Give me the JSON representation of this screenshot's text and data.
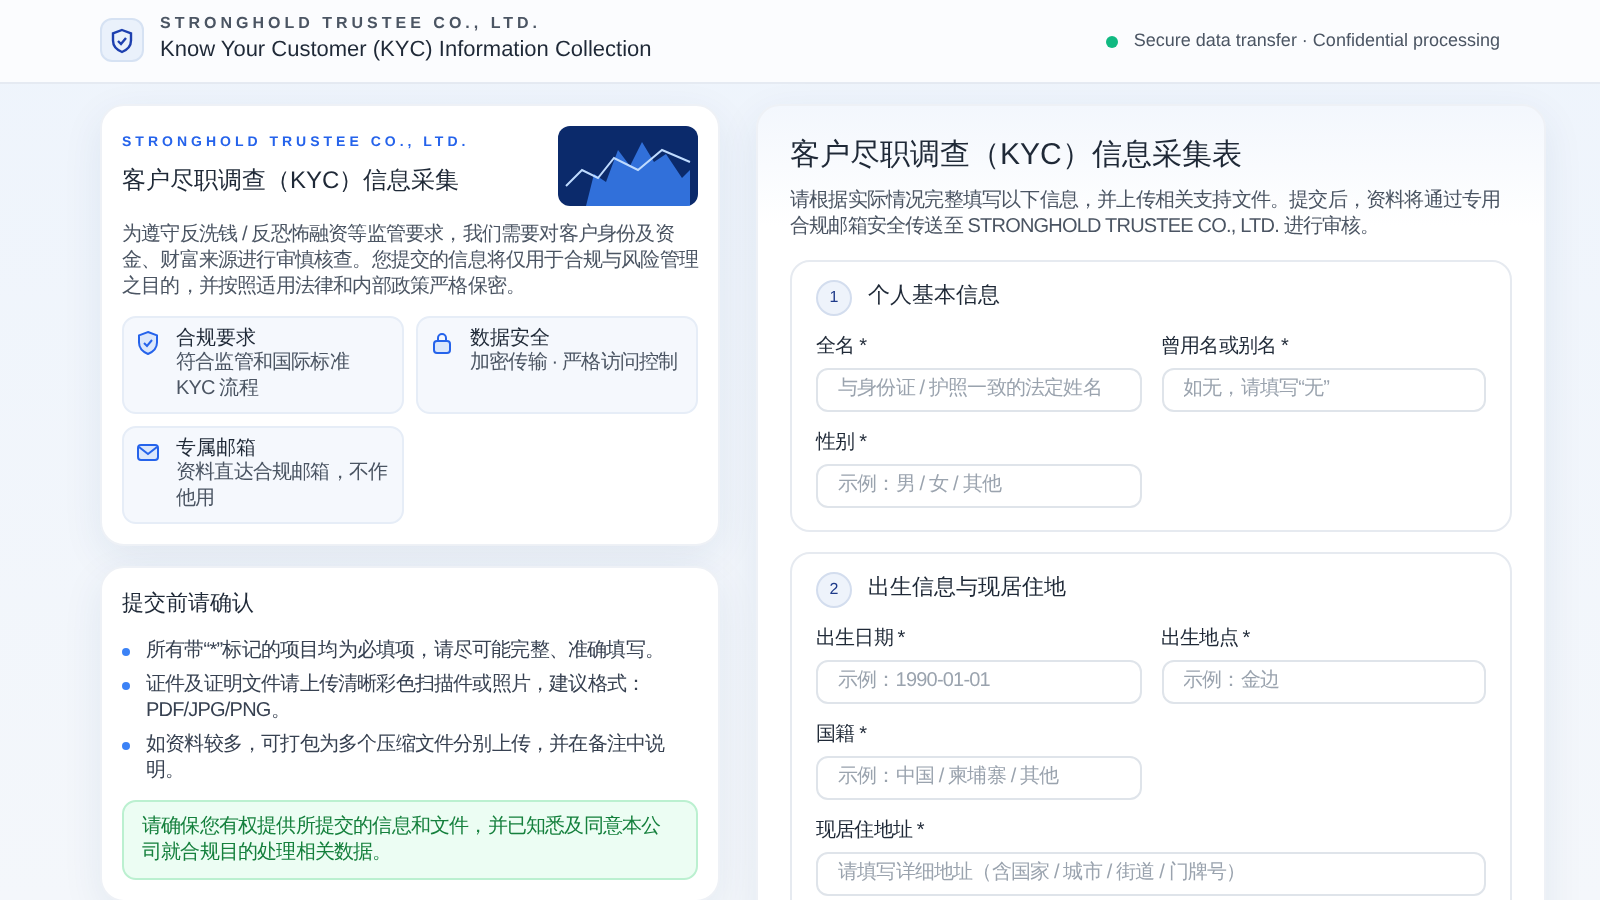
{
  "header": {
    "company": "STRONGHOLD TRUSTEE CO., LTD.",
    "title": "Know Your Customer (KYC) Information Collection",
    "status": "Secure data transfer · Confidential processing"
  },
  "intro_card": {
    "company": "STRONGHOLD TRUSTEE CO., LTD.",
    "title": "客户尽职调查（KYC）信息采集",
    "description": "为遵守反洗钱 / 反恐怖融资等监管要求，我们需要对客户身份及资金、财富来源进行审慎核查。您提交的信息将仅用于合规与风险管理之目的，并按照适用法律和内部政策严格保密。",
    "features": [
      {
        "kind": "shield",
        "title": "合规要求",
        "text": "符合监管和国际标准 KYC 流程"
      },
      {
        "kind": "lock",
        "title": "数据安全",
        "text": "加密传输 · 严格访问控制"
      },
      {
        "kind": "mail",
        "title": "专属邮箱",
        "text": "资料直达合规邮箱，不作他用"
      }
    ]
  },
  "confirm_card": {
    "title": "提交前请确认",
    "items": [
      "所有带“*”标记的项目均为必填项，请尽可能完整、准确填写。",
      "证件及证明文件请上传清晰彩色扫描件或照片，建议格式：PDF/JPG/PNG。",
      "如资料较多，可打包为多个压缩文件分别上传，并在备注中说明。"
    ],
    "note": "请确保您有权提供所提交的信息和文件，并已知悉及同意本公司就合规目的处理相关数据。"
  },
  "form": {
    "title": "客户尽职调查（KYC）信息采集表",
    "description": "请根据实际情况完整填写以下信息，并上传相关支持文件。提交后，资料将通过专用合规邮箱安全传送至 STRONGHOLD TRUSTEE CO., LTD. 进行审核。",
    "sections": [
      {
        "number": "1",
        "title": "个人基本信息",
        "fields": [
          {
            "kind": "half",
            "label": "全名 *",
            "placeholder": "与身份证 / 护照一致的法定姓名"
          },
          {
            "kind": "half",
            "label": "曾用名或别名 *",
            "placeholder": "如无，请填写“无”"
          },
          {
            "kind": "half",
            "label": "性别 *",
            "placeholder": "示例：男 / 女 / 其他"
          }
        ]
      },
      {
        "number": "2",
        "title": "出生信息与现居住地",
        "fields": [
          {
            "kind": "half",
            "label": "出生日期 *",
            "placeholder": "示例：1990-01-01"
          },
          {
            "kind": "half",
            "label": "出生地点 *",
            "placeholder": "示例：金边"
          },
          {
            "kind": "half",
            "label": "国籍 *",
            "placeholder": "示例：中国 / 柬埔寨 / 其他"
          },
          {
            "kind": "full",
            "label": "现居住地址 *",
            "placeholder": "请填写详细地址（含国家 / 城市 / 街道 / 门牌号）"
          }
        ]
      }
    ]
  }
}
